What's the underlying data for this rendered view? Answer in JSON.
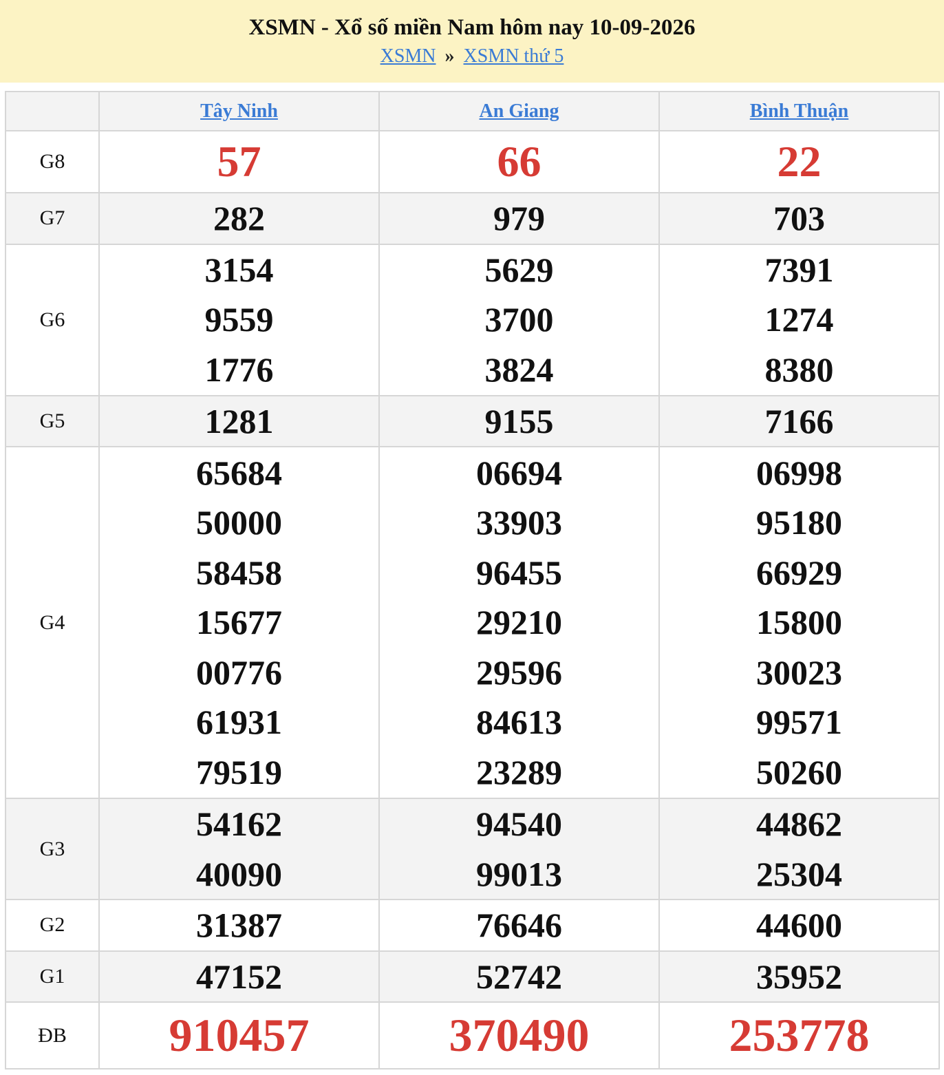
{
  "header": {
    "title": "XSMN - Xổ số miền Nam hôm nay 10-09-2026",
    "crumb_1": "XSMN",
    "separator": "»",
    "crumb_2": "XSMN thứ 5"
  },
  "colors": {
    "header_bg": "#fcf3c4",
    "link": "#3a7bd5",
    "highlight": "#d63b34",
    "row_alt": "#f3f3f3"
  },
  "provinces": [
    "Tây Ninh",
    "An Giang",
    "Bình Thuận"
  ],
  "prizes": [
    {
      "label": "G8",
      "values": [
        [
          "57"
        ],
        [
          "66"
        ],
        [
          "22"
        ]
      ]
    },
    {
      "label": "G7",
      "values": [
        [
          "282"
        ],
        [
          "979"
        ],
        [
          "703"
        ]
      ]
    },
    {
      "label": "G6",
      "values": [
        [
          "3154",
          "9559",
          "1776"
        ],
        [
          "5629",
          "3700",
          "3824"
        ],
        [
          "7391",
          "1274",
          "8380"
        ]
      ]
    },
    {
      "label": "G5",
      "values": [
        [
          "1281"
        ],
        [
          "9155"
        ],
        [
          "7166"
        ]
      ]
    },
    {
      "label": "G4",
      "values": [
        [
          "65684",
          "50000",
          "58458",
          "15677",
          "00776",
          "61931",
          "79519"
        ],
        [
          "06694",
          "33903",
          "96455",
          "29210",
          "29596",
          "84613",
          "23289"
        ],
        [
          "06998",
          "95180",
          "66929",
          "15800",
          "30023",
          "99571",
          "50260"
        ]
      ]
    },
    {
      "label": "G3",
      "values": [
        [
          "54162",
          "40090"
        ],
        [
          "94540",
          "99013"
        ],
        [
          "44862",
          "25304"
        ]
      ]
    },
    {
      "label": "G2",
      "values": [
        [
          "31387"
        ],
        [
          "76646"
        ],
        [
          "44600"
        ]
      ]
    },
    {
      "label": "G1",
      "values": [
        [
          "47152"
        ],
        [
          "52742"
        ],
        [
          "35952"
        ]
      ]
    },
    {
      "label": "ĐB",
      "values": [
        [
          "910457"
        ],
        [
          "370490"
        ],
        [
          "253778"
        ]
      ]
    }
  ]
}
